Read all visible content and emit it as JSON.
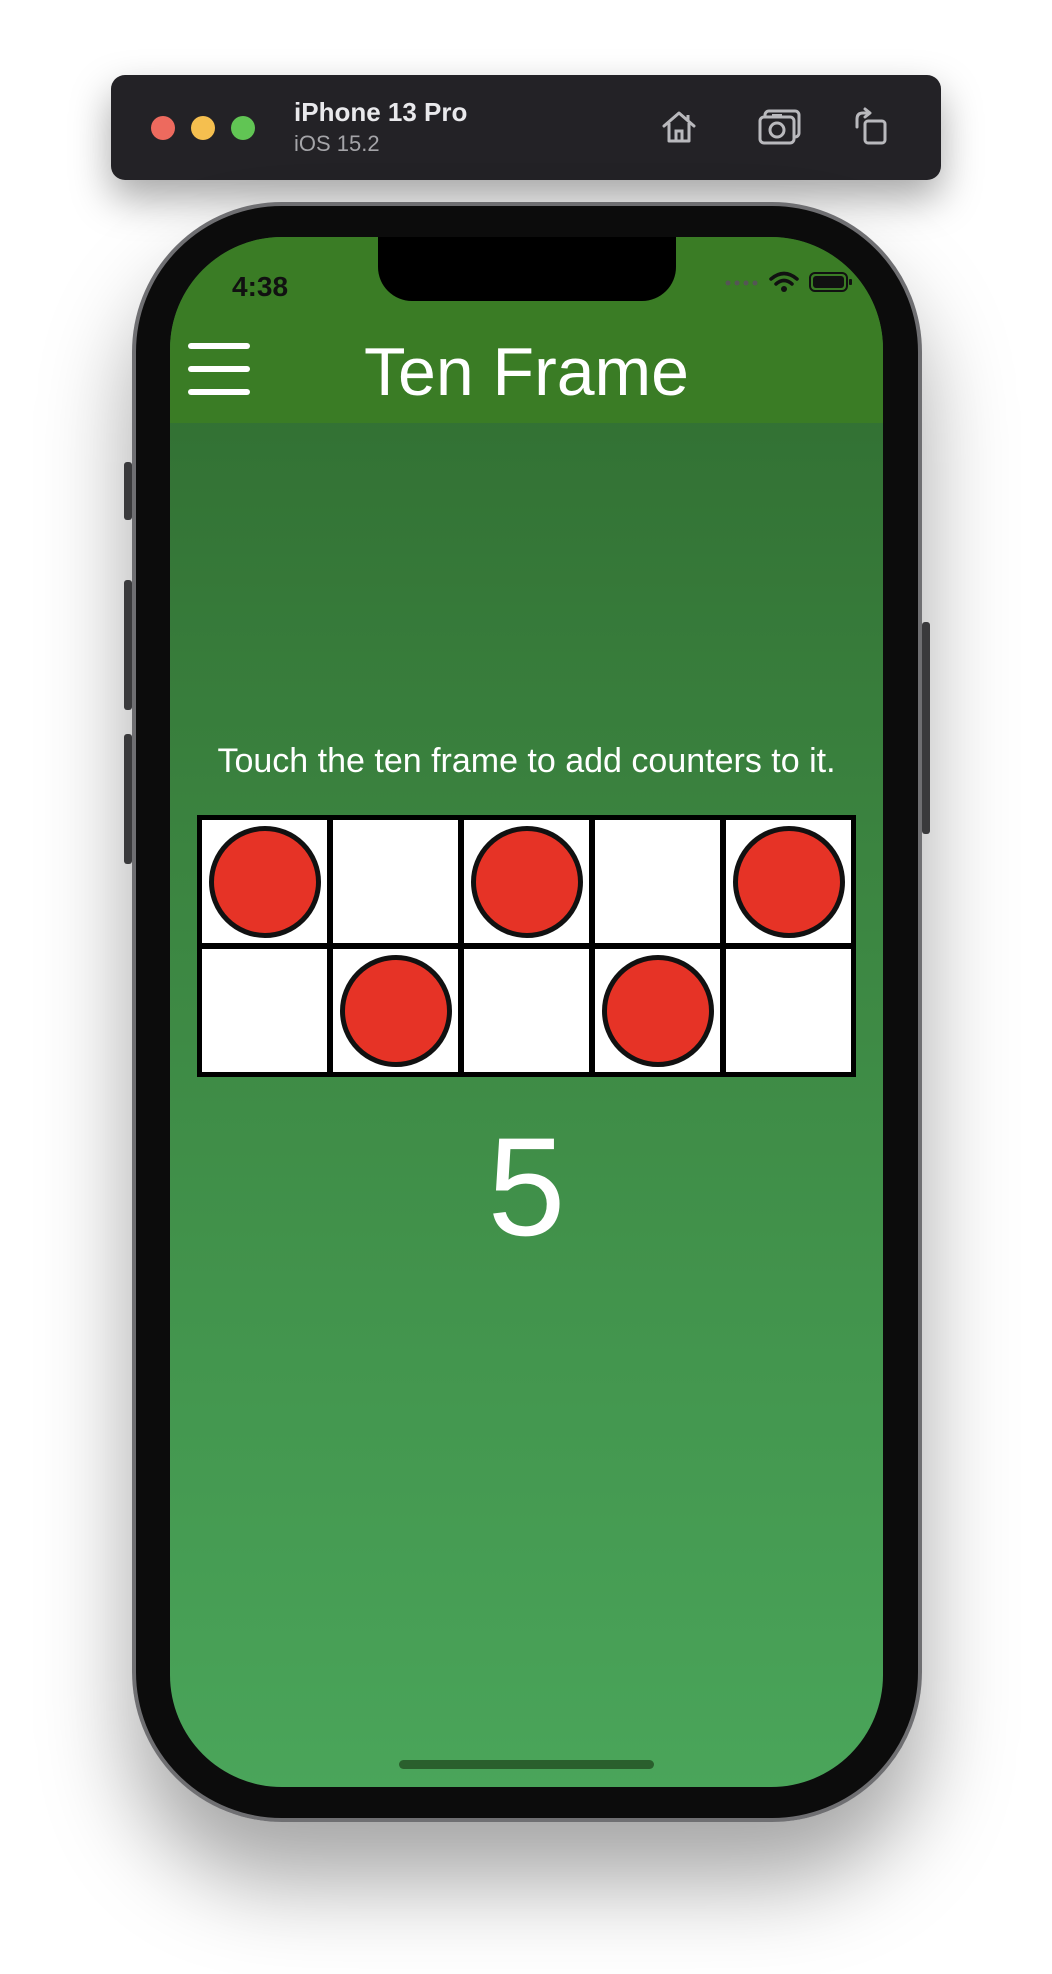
{
  "simulator": {
    "device_name": "iPhone 13 Pro",
    "os_version": "iOS 15.2",
    "buttons": [
      "home-icon",
      "screenshot-icon",
      "rotate-icon"
    ]
  },
  "status_bar": {
    "time": "4:38",
    "icons": [
      "signal-icon",
      "wifi-icon",
      "battery-icon"
    ]
  },
  "header": {
    "title": "Ten Frame",
    "menu_icon": "hamburger-menu-icon",
    "background": "#3a7c25"
  },
  "instructions": "Touch the ten frame to add counters to it.",
  "ten_frame": {
    "rows": [
      [
        true,
        false,
        true,
        false,
        true
      ],
      [
        false,
        true,
        false,
        true,
        false
      ]
    ],
    "counter_color": "#e63326"
  },
  "count": "5"
}
